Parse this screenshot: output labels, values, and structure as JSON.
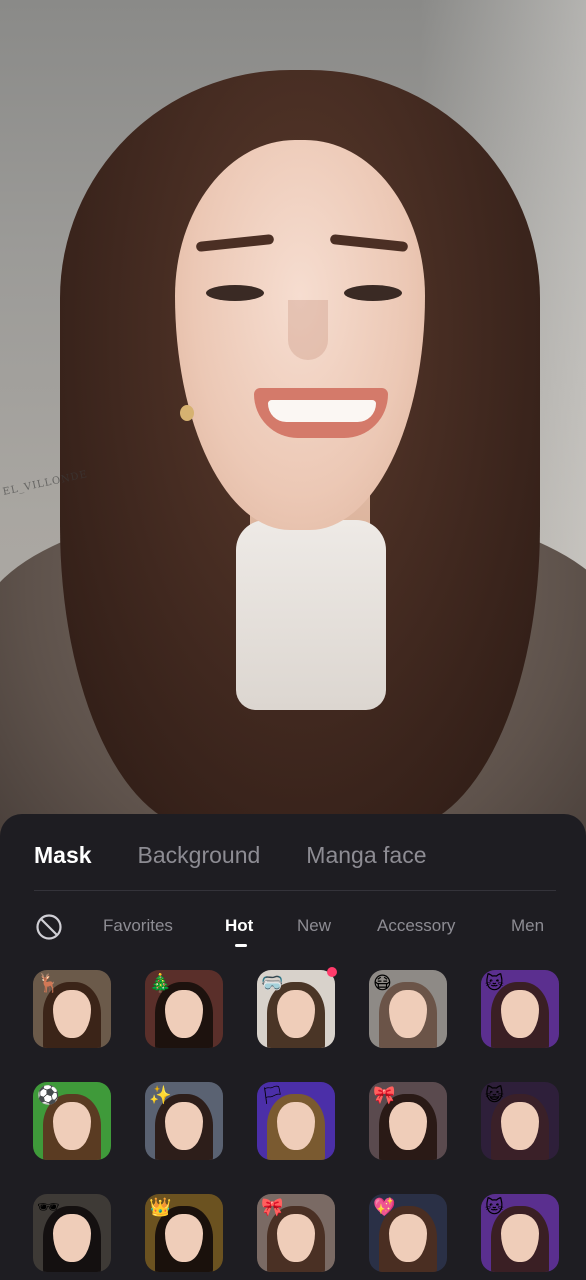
{
  "sheet": {
    "tabs": [
      "Mask",
      "Background",
      "Manga face"
    ],
    "active_tab": "Mask",
    "categories": [
      "Favorites",
      "Hot",
      "New",
      "Accessory",
      "Men"
    ],
    "active_category": "Hot",
    "none_icon": "no-effect-icon"
  },
  "preview": {
    "wall_text": "EL_VILLONDE"
  },
  "masks": [
    {
      "name": "golden-antlers-mask",
      "bg": "#6b5a4a",
      "hair": "#3b2418",
      "deco": "🦌"
    },
    {
      "name": "christmas-crown-mask",
      "bg": "#5a2f2a",
      "hair": "#1d120e",
      "deco": "🎄"
    },
    {
      "name": "goggles-mask",
      "bg": "#d8d2cb",
      "hair": "#4a3526",
      "deco": "🥽",
      "new_dot": true
    },
    {
      "name": "pink-face-mask",
      "bg": "#8e8a86",
      "hair": "#6b5448",
      "deco": "😷"
    },
    {
      "name": "purple-cat-ears-mask",
      "bg": "#5b2f8f",
      "hair": "#3a1f24",
      "deco": "🐱"
    },
    {
      "name": "soccer-fan-mask",
      "bg": "#3f9a3a",
      "hair": "#5a3b22",
      "deco": "⚽"
    },
    {
      "name": "glitter-eye-mask",
      "bg": "#5a6272",
      "hair": "#2d1e1a",
      "deco": "✨"
    },
    {
      "name": "flag-paint-mask",
      "bg": "#4b2fa8",
      "hair": "#7a5a30",
      "deco": "🏳"
    },
    {
      "name": "pink-bow-mask",
      "bg": "#5a4a4e",
      "hair": "#2a1a16",
      "deco": "🎀"
    },
    {
      "name": "neon-cat-ears-mask",
      "bg": "#2e1f3a",
      "hair": "#3a2028",
      "deco": "😺"
    },
    {
      "name": "sunglasses-man-mask",
      "bg": "#3e3a36",
      "hair": "#141010",
      "deco": "🕶"
    },
    {
      "name": "gold-chain-mask",
      "bg": "#6b5220",
      "hair": "#1a110c",
      "deco": "👑"
    },
    {
      "name": "blue-bow-mask",
      "bg": "#7a6a64",
      "hair": "#4a3024",
      "deco": "🎀"
    },
    {
      "name": "heart-crown-mask",
      "bg": "#2a3046",
      "hair": "#4a2e22",
      "deco": "💖"
    },
    {
      "name": "purple-ears-mask",
      "bg": "#5a2f8f",
      "hair": "#3a1f24",
      "deco": "🐱"
    }
  ]
}
